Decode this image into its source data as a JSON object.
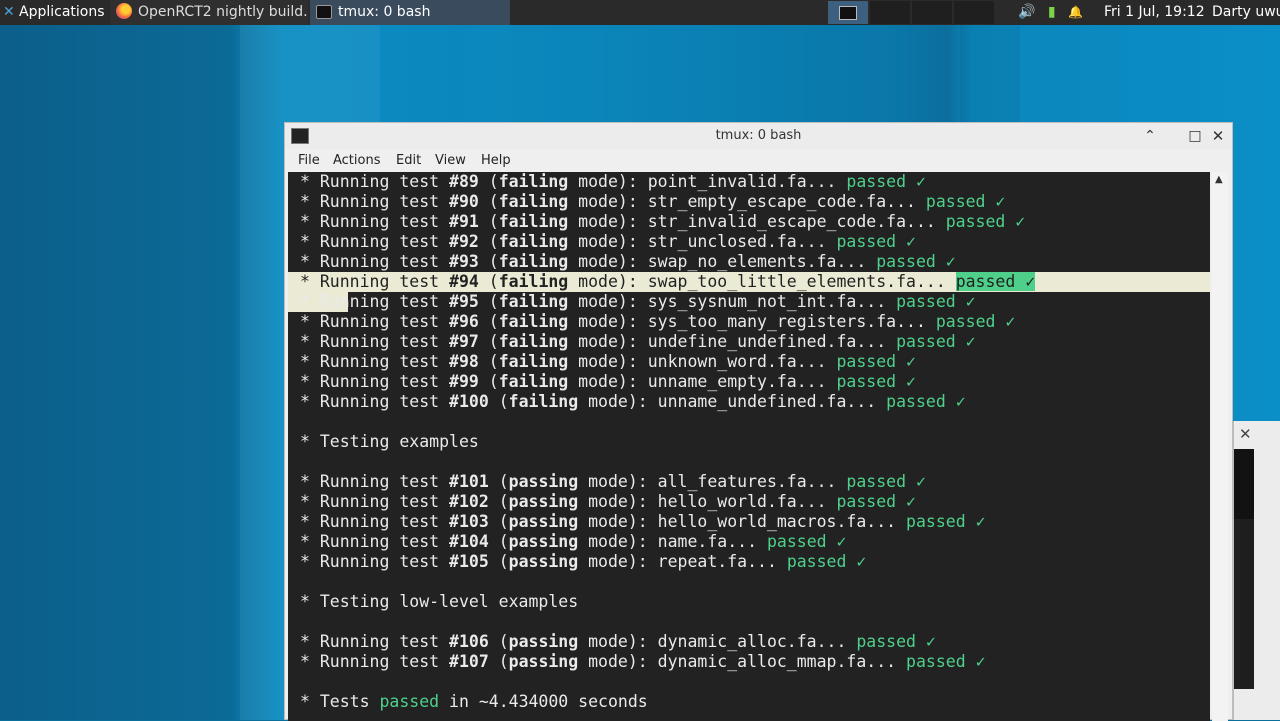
{
  "panel": {
    "applications_label": "Applications",
    "tasks": [
      {
        "label": "OpenRCT2 nightly build...",
        "icon": "firefox-icon"
      },
      {
        "label": "tmux: 0 bash",
        "icon": "terminal-icon"
      }
    ],
    "tray": {
      "volume_icon": "🔊",
      "battery_icon": "▮",
      "bell_icon": "🔔"
    },
    "clock": "Fri  1 Jul, 19:12",
    "user": "Darty uwu"
  },
  "window": {
    "title": "tmux: 0 bash",
    "controls": {
      "minimize": "⌃",
      "maximize": "□",
      "close": "✕"
    },
    "menu": [
      "File",
      "Actions",
      "Edit",
      "View",
      "Help"
    ]
  },
  "terminal": {
    "colors": {
      "background": "#222222",
      "text": "#eaeaea",
      "passed": "#4fd08a",
      "highlight": "#ebebd5"
    },
    "lines": [
      {
        "kind": "test",
        "num": "#89",
        "mode": "failing",
        "file": "point_invalid.fa..."
      },
      {
        "kind": "test",
        "num": "#90",
        "mode": "failing",
        "file": "str_empty_escape_code.fa..."
      },
      {
        "kind": "test",
        "num": "#91",
        "mode": "failing",
        "file": "str_invalid_escape_code.fa..."
      },
      {
        "kind": "test",
        "num": "#92",
        "mode": "failing",
        "file": "str_unclosed.fa..."
      },
      {
        "kind": "test",
        "num": "#93",
        "mode": "failing",
        "file": "swap_no_elements.fa..."
      },
      {
        "kind": "test",
        "num": "#94",
        "mode": "failing",
        "file": "swap_too_little_elements.fa...",
        "highlight": true
      },
      {
        "kind": "test",
        "num": "#95",
        "mode": "failing",
        "file": "sys_sysnum_not_int.fa..."
      },
      {
        "kind": "test",
        "num": "#96",
        "mode": "failing",
        "file": "sys_too_many_registers.fa..."
      },
      {
        "kind": "test",
        "num": "#97",
        "mode": "failing",
        "file": "undefine_undefined.fa..."
      },
      {
        "kind": "test",
        "num": "#98",
        "mode": "failing",
        "file": "unknown_word.fa..."
      },
      {
        "kind": "test",
        "num": "#99",
        "mode": "failing",
        "file": "unname_empty.fa..."
      },
      {
        "kind": "test",
        "num": "#100",
        "mode": "failing",
        "file": "unname_undefined.fa..."
      },
      {
        "kind": "blank"
      },
      {
        "kind": "section",
        "text": "* Testing examples"
      },
      {
        "kind": "blank"
      },
      {
        "kind": "test",
        "num": "#101",
        "mode": "passing",
        "file": "all_features.fa..."
      },
      {
        "kind": "test",
        "num": "#102",
        "mode": "passing",
        "file": "hello_world.fa..."
      },
      {
        "kind": "test",
        "num": "#103",
        "mode": "passing",
        "file": "hello_world_macros.fa..."
      },
      {
        "kind": "test",
        "num": "#104",
        "mode": "passing",
        "file": "name.fa..."
      },
      {
        "kind": "test",
        "num": "#105",
        "mode": "passing",
        "file": "repeat.fa..."
      },
      {
        "kind": "blank"
      },
      {
        "kind": "section",
        "text": "* Testing low-level examples"
      },
      {
        "kind": "blank"
      },
      {
        "kind": "test",
        "num": "#106",
        "mode": "passing",
        "file": "dynamic_alloc.fa..."
      },
      {
        "kind": "test",
        "num": "#107",
        "mode": "passing",
        "file": "dynamic_alloc_mmap.fa..."
      },
      {
        "kind": "blank"
      },
      {
        "kind": "summary",
        "prefix": "* Tests ",
        "word": "passed",
        "suffix": " in ~4.434000 seconds"
      }
    ],
    "strings": {
      "bullet": "* ",
      "running": "Running test ",
      "mode_suffix": " mode): ",
      "passed": "passed",
      "check": "✓"
    }
  }
}
